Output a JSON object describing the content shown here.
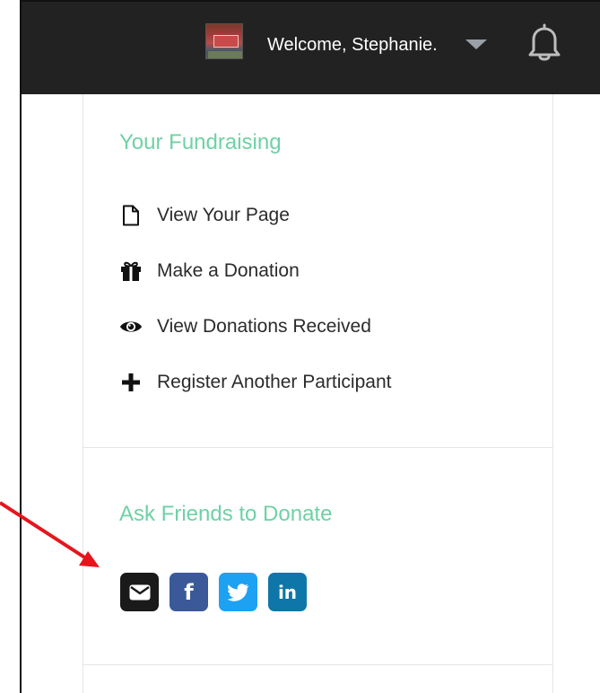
{
  "header": {
    "welcome_text": "Welcome, Stephanie."
  },
  "fundraising": {
    "title": "Your Fundraising",
    "items": [
      {
        "label": "View Your Page",
        "icon": "file-icon"
      },
      {
        "label": "Make a Donation",
        "icon": "gift-icon"
      },
      {
        "label": "View Donations Received",
        "icon": "eye-icon"
      },
      {
        "label": "Register Another Participant",
        "icon": "plus-icon"
      }
    ]
  },
  "ask_friends": {
    "title": "Ask Friends to Donate",
    "buttons": [
      {
        "icon": "email-icon",
        "color": "#1a1a1a"
      },
      {
        "icon": "facebook-icon",
        "glyph": "f",
        "color": "#3b5998"
      },
      {
        "icon": "twitter-icon",
        "color": "#1da1f2"
      },
      {
        "icon": "linkedin-icon",
        "glyph": "in",
        "color": "#0e76a8"
      }
    ]
  },
  "colors": {
    "topbar": "#222222",
    "section_title": "#6fd1a6",
    "annotation_arrow": "#e8141c"
  }
}
